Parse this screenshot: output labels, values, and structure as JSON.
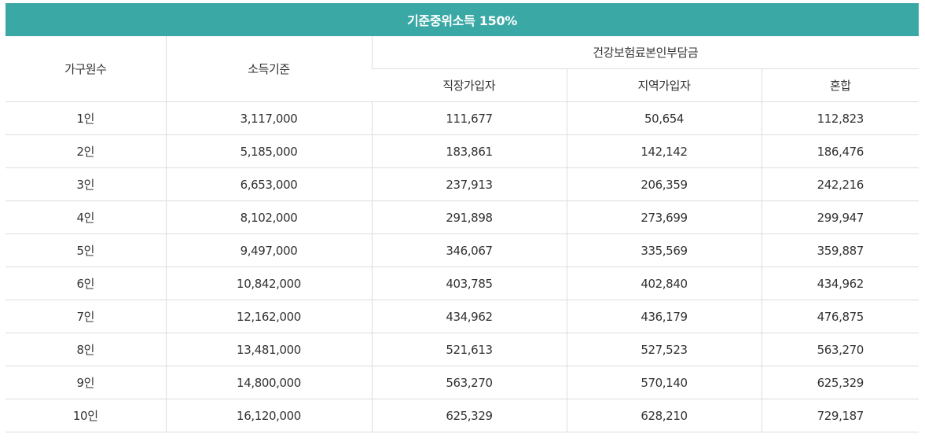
{
  "title": "기준중위소득 150%",
  "headers": {
    "household": "가구원수",
    "income": "소득기준",
    "insurance_group": "건강보험료본인부담금",
    "employee": "직장가입자",
    "regional": "지역가입자",
    "mixed": "혼합"
  },
  "rows": [
    {
      "household": "1인",
      "income": "3,117,000",
      "employee": "111,677",
      "regional": "50,654",
      "mixed": "112,823"
    },
    {
      "household": "2인",
      "income": "5,185,000",
      "employee": "183,861",
      "regional": "142,142",
      "mixed": "186,476"
    },
    {
      "household": "3인",
      "income": "6,653,000",
      "employee": "237,913",
      "regional": "206,359",
      "mixed": "242,216"
    },
    {
      "household": "4인",
      "income": "8,102,000",
      "employee": "291,898",
      "regional": "273,699",
      "mixed": "299,947"
    },
    {
      "household": "5인",
      "income": "9,497,000",
      "employee": "346,067",
      "regional": "335,569",
      "mixed": "359,887"
    },
    {
      "household": "6인",
      "income": "10,842,000",
      "employee": "403,785",
      "regional": "402,840",
      "mixed": "434,962"
    },
    {
      "household": "7인",
      "income": "12,162,000",
      "employee": "434,962",
      "regional": "436,179",
      "mixed": "476,875"
    },
    {
      "household": "8인",
      "income": "13,481,000",
      "employee": "521,613",
      "regional": "527,523",
      "mixed": "563,270"
    },
    {
      "household": "9인",
      "income": "14,800,000",
      "employee": "563,270",
      "regional": "570,140",
      "mixed": "625,329"
    },
    {
      "household": "10인",
      "income": "16,120,000",
      "employee": "625,329",
      "regional": "628,210",
      "mixed": "729,187"
    }
  ],
  "colors": {
    "title_background": "#3aa9a6",
    "title_text": "#ffffff",
    "border": "#dddddd",
    "text": "#333333"
  }
}
